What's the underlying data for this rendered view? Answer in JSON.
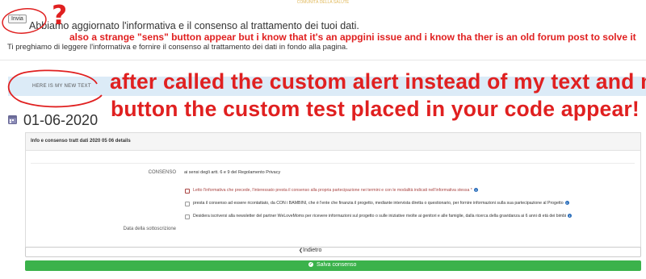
{
  "header": {
    "logo_text": "COMUNITÀ DELLA SALUTE",
    "invia_label": "Invia",
    "welcome": "Abbiamo aggiornato l'informativa e il consenso al trattamento dei tuoi dati.",
    "privacy_request": "Ti preghiamo di leggere l'informativa e fornire il consenso al trattamento dei dati in fondo alla pagina."
  },
  "annotations": {
    "question_mark": "?",
    "top_note": "also a strange \"sens\" button appear but i know that it's an appgini issue and i know tha ther is an old forum post to solve it",
    "big_line1": "after called the custom alert instead of my text and my",
    "big_line2": "button the custom test placed in your code appear!"
  },
  "alert": {
    "text": "HERE IS MY NEW TEXT"
  },
  "record": {
    "date": "01-06-2020",
    "icon": "calendar-icon"
  },
  "panel": {
    "title": "Info e consenso tratt dati 2020 05 06 details",
    "consenso_label": "CONSENSO",
    "consenso_intro": "ai sensi degli artt. 6 e 9 del Regolamento Privacy",
    "options": [
      {
        "text": "Letto l'informativa che precede, l'interessato presta il consenso alla propria partecipazione nei termini e con le modalità indicati nell'informativa stessa *",
        "required": true
      },
      {
        "text": "presta il consenso ad essere ricontattato, da CON i BAMBINI, che è l'ente che finanzia il progetto, mediante intervista diretta o questionario, per fornire informazioni sulla sua partecipazione al Progetto",
        "required": false
      },
      {
        "text": "Desidera iscriversi alla newsletter del partner WeLoveMoms per ricevere informazioni sul progetto o sulle iniziative rivolte ai genitori e alle famiglie, dalla ricerca della gravidanza ai 6 anni di età dei bimbi",
        "required": false
      }
    ],
    "data_label": "Data della sottoscrizione"
  },
  "buttons": {
    "back_label": "Indietro",
    "save_label": "Salva consenso"
  },
  "colors": {
    "annotation_red": "#e02020",
    "alert_bg": "#dcebf7",
    "save_green": "#3bb24b",
    "required_red": "#a94442",
    "info_blue": "#2a6ebb"
  }
}
